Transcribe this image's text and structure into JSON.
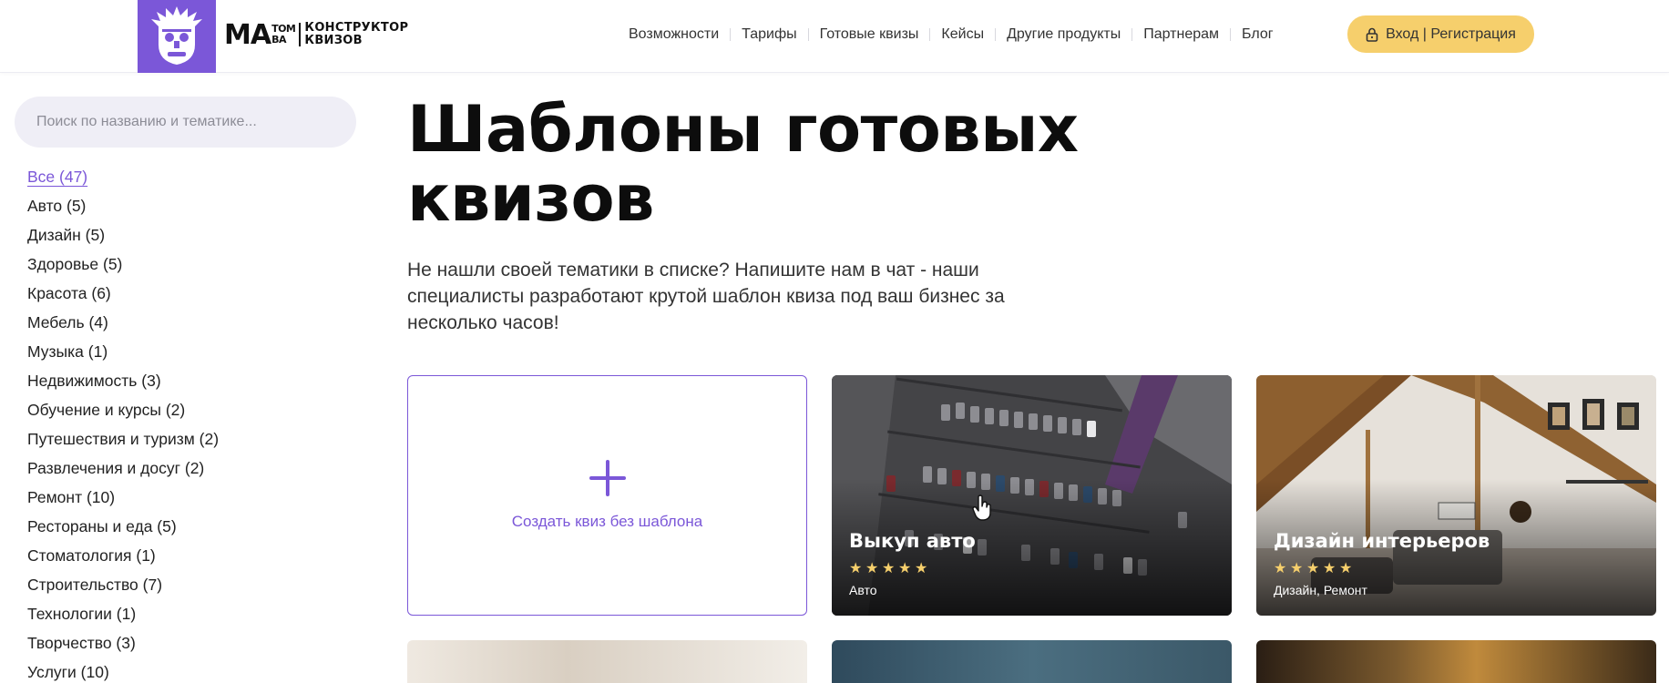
{
  "brand": {
    "mark": "МА",
    "mark_top": "ТОМ",
    "mark_bottom": "ВА",
    "sub_top": "КОНСТРУКТОР",
    "sub_bottom": "КВИЗОВ",
    "accent": "#7b57d8",
    "button_color": "#f6cf6c"
  },
  "nav": {
    "items": [
      "Возможности",
      "Тарифы",
      "Готовые квизы",
      "Кейсы",
      "Другие продукты",
      "Партнерам",
      "Блог"
    ],
    "login_label": "Вход | Регистрация",
    "login_icon": "lock-icon"
  },
  "search": {
    "placeholder": "Поиск по названию и тематике..."
  },
  "categories": [
    "Все (47)",
    "Авто (5)",
    "Дизайн (5)",
    "Здоровье (5)",
    "Красота (6)",
    "Мебель (4)",
    "Музыка (1)",
    "Недвижимость (3)",
    "Обучение и курсы (2)",
    "Путешествия и туризм (2)",
    "Развлечения и досуг (2)",
    "Ремонт (10)",
    "Рестораны и еда (5)",
    "Стоматология (1)",
    "Строительство (7)",
    "Технологии (1)",
    "Творчество (3)",
    "Услуги (10)"
  ],
  "active_category": 0,
  "page": {
    "title_line1": "Шаблоны готовых",
    "title_line2": "квизов",
    "lead": "Не нашли своей тематики в списке? Напишите нам в чат - наши специалисты разработают крутой шаблон квиза под ваш бизнес за несколько часов!"
  },
  "create_card": {
    "label": "Создать квиз без шаблона",
    "icon": "plus-icon"
  },
  "templates": [
    {
      "title": "Выкуп авто",
      "rating": 5,
      "tags": "Авто"
    },
    {
      "title": "Дизайн интерьеров",
      "rating": 5,
      "tags": "Дизайн, Ремонт"
    }
  ]
}
